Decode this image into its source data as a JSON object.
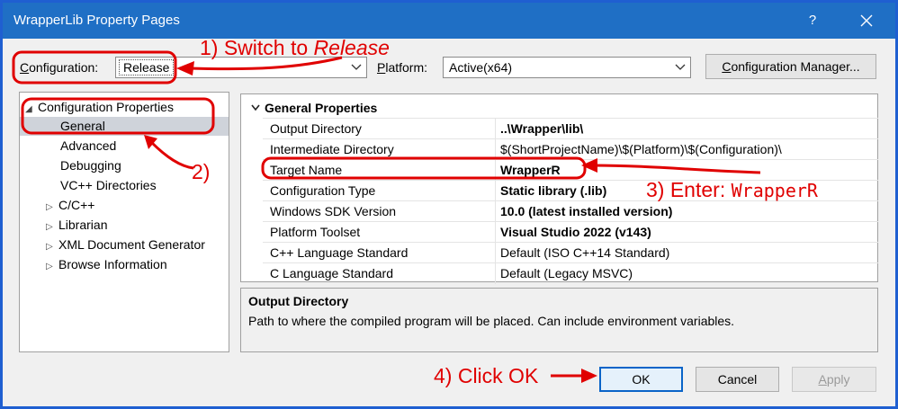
{
  "window": {
    "title": "WrapperLib Property Pages",
    "help_label": "?",
    "close_icon": "close-icon"
  },
  "toolbar": {
    "configuration_label_first": "C",
    "configuration_label_rest": "onfiguration:",
    "configuration_value": "Release",
    "platform_label_first": "P",
    "platform_label_rest": "latform:",
    "platform_value": "Active(x64)",
    "config_manager_first": "C",
    "config_manager_rest": "onfiguration Manager..."
  },
  "tree": {
    "items": [
      {
        "label": "Configuration Properties",
        "expander": "◢"
      },
      {
        "label": "General"
      },
      {
        "label": "Advanced"
      },
      {
        "label": "Debugging"
      },
      {
        "label": "VC++ Directories"
      },
      {
        "label": "C/C++",
        "expander": "▷"
      },
      {
        "label": "Librarian",
        "expander": "▷"
      },
      {
        "label": "XML Document Generator",
        "expander": "▷"
      },
      {
        "label": "Browse Information",
        "expander": "▷"
      }
    ]
  },
  "grid": {
    "section": "General Properties",
    "rows": [
      {
        "name": "Output Directory",
        "value": "..\\Wrapper\\lib\\"
      },
      {
        "name": "Intermediate Directory",
        "value": "$(ShortProjectName)\\$(Platform)\\$(Configuration)\\"
      },
      {
        "name": "Target Name",
        "value": "WrapperR"
      },
      {
        "name": "Configuration Type",
        "value": "Static library (.lib)"
      },
      {
        "name": "Windows SDK Version",
        "value": "10.0 (latest installed version)"
      },
      {
        "name": "Platform Toolset",
        "value": "Visual Studio 2022 (v143)"
      },
      {
        "name": "C++ Language Standard",
        "value": "Default (ISO C++14 Standard)"
      },
      {
        "name": "C Language Standard",
        "value": "Default (Legacy MSVC)"
      }
    ]
  },
  "description": {
    "title": "Output Directory",
    "text": "Path to where the compiled program will be placed. Can include environment variables."
  },
  "buttons": {
    "ok": "OK",
    "cancel": "Cancel",
    "apply_first": "A",
    "apply_rest": "pply"
  },
  "annotations": {
    "step1_prefix": "1) Switch to ",
    "step1_emph": "Release",
    "step2": "2)",
    "step3_prefix": "3) Enter: ",
    "step3_code": "WrapperR",
    "step4": "4) Click OK",
    "color": "#e00000"
  },
  "colors": {
    "titlebar": "#1f6fc5",
    "border": "#1f5fd1",
    "selection": "#cfd3da"
  }
}
